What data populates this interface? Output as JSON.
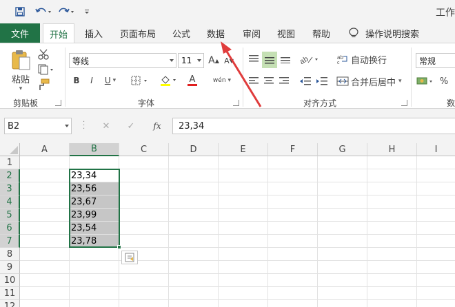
{
  "title": "工作",
  "tabs": [
    "文件",
    "开始",
    "插入",
    "页面布局",
    "公式",
    "数据",
    "审阅",
    "视图",
    "帮助",
    "操作说明搜索"
  ],
  "clipboard": {
    "paste_label": "粘贴",
    "group_label": "剪贴板"
  },
  "font": {
    "name": "等线",
    "size": "11",
    "group_label": "字体",
    "bold": "B",
    "italic": "I",
    "underline": "U",
    "grow": "A",
    "shrink": "A",
    "font_color_glyph": "A",
    "phonetic": "wén"
  },
  "alignment": {
    "wrap_text": "自动换行",
    "merge_center": "合并后居中",
    "group_label": "对齐方式"
  },
  "number": {
    "format": "常规",
    "percent": "%",
    "group_label": "数"
  },
  "formula_bar": {
    "name_box": "B2",
    "cancel": "✕",
    "enter": "✓",
    "fx": "fx",
    "content": "23,34"
  },
  "columns": [
    "A",
    "B",
    "C",
    "D",
    "E",
    "F",
    "G",
    "H",
    "I"
  ],
  "rows": [
    "1",
    "2",
    "3",
    "4",
    "5",
    "6",
    "7",
    "8",
    "9",
    "10",
    "11",
    "12"
  ],
  "cells": [
    {
      "row": 2,
      "col": "B",
      "value": "23,34"
    },
    {
      "row": 3,
      "col": "B",
      "value": "23,56"
    },
    {
      "row": 4,
      "col": "B",
      "value": "23,67"
    },
    {
      "row": 5,
      "col": "B",
      "value": "23,99"
    },
    {
      "row": 6,
      "col": "B",
      "value": "23,54"
    },
    {
      "row": 7,
      "col": "B",
      "value": "23,78"
    }
  ],
  "selection": "B2:B7",
  "colors": {
    "accent": "#217346",
    "selection_fill": "#c6c6c6",
    "arrow": "#e03c3c"
  }
}
